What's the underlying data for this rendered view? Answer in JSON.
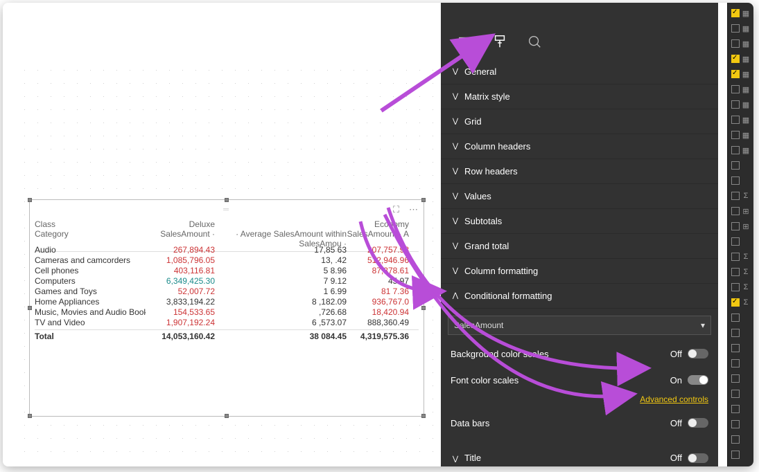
{
  "matrix": {
    "header_row1": {
      "class": "Class",
      "deluxe": "Deluxe",
      "economy": "Economy"
    },
    "header_row2": {
      "category": "Category",
      "sales1": "SalesAmount",
      "avg": "Average SalesAmount within SalesAmou",
      "sales2": "SalesAmount",
      "a": "A"
    },
    "rows": [
      {
        "cat": "Audio",
        "v1": "267,894.43",
        "v1c": "red",
        "v2": "17,85   63",
        "v3": "207,757.98",
        "v3c": "red"
      },
      {
        "cat": "Cameras and camcorders",
        "v1": "1,085,796.05",
        "v1c": "red",
        "v2": "13,     .42",
        "v3": "512,946.96",
        "v3c": "red"
      },
      {
        "cat": "Cell phones",
        "v1": "403,116.81",
        "v1c": "red",
        "v2": "5    8.96",
        "v3": "87,378.61",
        "v3c": "red"
      },
      {
        "cat": "Computers",
        "v1": "6,349,425.30",
        "v1c": "teal",
        "v2": "7    9.12",
        "v3": "      45.97",
        "v3c": ""
      },
      {
        "cat": "Games and Toys",
        "v1": "52,007.72",
        "v1c": "red",
        "v2": "1   6.99",
        "v3": "81     7.36",
        "v3c": "red"
      },
      {
        "cat": "Home Appliances",
        "v1": "3,833,194.22",
        "v1c": "",
        "v2": "8  ,182.09",
        "v3": "936,767.0 ",
        "v3c": "red"
      },
      {
        "cat": "Music, Movies and Audio Books",
        "v1": "154,533.65",
        "v1c": "red",
        "v2": "   ,726.68",
        "v3": "18,420.94",
        "v3c": "red"
      },
      {
        "cat": "TV and Video",
        "v1": "1,907,192.24",
        "v1c": "red",
        "v2": "6  ,573.07",
        "v3": "888,360.49",
        "v3c": ""
      }
    ],
    "total": {
      "cat": "Total",
      "v1": "14,053,160.42",
      "v2": "38  084.45",
      "v3": "4,319,575.36"
    }
  },
  "sections": [
    {
      "label": "General",
      "expanded": false
    },
    {
      "label": "Matrix style",
      "expanded": false
    },
    {
      "label": "Grid",
      "expanded": false
    },
    {
      "label": "Column headers",
      "expanded": false
    },
    {
      "label": "Row headers",
      "expanded": false
    },
    {
      "label": "Values",
      "expanded": false
    },
    {
      "label": "Subtotals",
      "expanded": false
    },
    {
      "label": "Grand total",
      "expanded": false
    },
    {
      "label": "Column formatting",
      "expanded": false
    },
    {
      "label": "Conditional formatting",
      "expanded": true
    }
  ],
  "cf": {
    "field": "SalesAmount",
    "bg_scales": {
      "label": "Background color scales",
      "value": "Off"
    },
    "font_scales": {
      "label": "Font color scales",
      "value": "On"
    },
    "adv": "Advanced controls",
    "data_bars": {
      "label": "Data bars",
      "value": "Off"
    }
  },
  "title_section": {
    "label": "Title",
    "value": "Off"
  },
  "field_items": [
    {
      "chk": true,
      "icon": "▦"
    },
    {
      "chk": false,
      "icon": "▦"
    },
    {
      "chk": false,
      "icon": "▦"
    },
    {
      "chk": true,
      "icon": "▦"
    },
    {
      "chk": true,
      "icon": "▦"
    },
    {
      "chk": false,
      "icon": "▦"
    },
    {
      "chk": false,
      "icon": "▦"
    },
    {
      "chk": false,
      "icon": "▦"
    },
    {
      "chk": false,
      "icon": "▦"
    },
    {
      "chk": false,
      "icon": "▦"
    },
    {
      "chk": false,
      "icon": ""
    },
    {
      "chk": false,
      "icon": ""
    },
    {
      "chk": false,
      "icon": "Σ"
    },
    {
      "chk": false,
      "icon": "⊞"
    },
    {
      "chk": false,
      "icon": "⊞"
    },
    {
      "chk": false,
      "icon": ""
    },
    {
      "chk": false,
      "icon": "Σ"
    },
    {
      "chk": false,
      "icon": "Σ"
    },
    {
      "chk": false,
      "icon": "Σ"
    },
    {
      "chk": true,
      "icon": "Σ"
    },
    {
      "chk": false,
      "icon": ""
    },
    {
      "chk": false,
      "icon": ""
    },
    {
      "chk": false,
      "icon": ""
    },
    {
      "chk": false,
      "icon": ""
    },
    {
      "chk": false,
      "icon": ""
    },
    {
      "chk": false,
      "icon": ""
    },
    {
      "chk": false,
      "icon": ""
    },
    {
      "chk": false,
      "icon": ""
    },
    {
      "chk": false,
      "icon": ""
    },
    {
      "chk": false,
      "icon": ""
    }
  ]
}
